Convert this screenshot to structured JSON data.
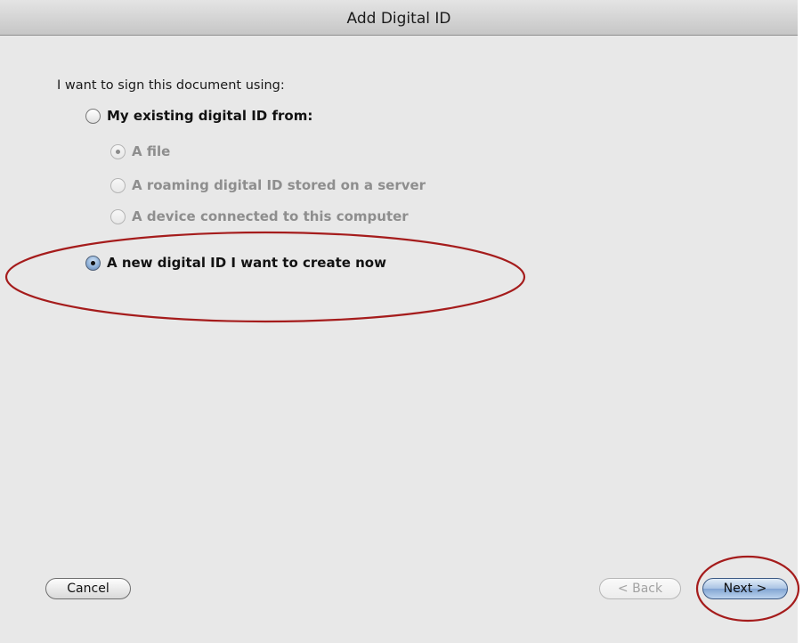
{
  "dialog": {
    "title": "Add Digital ID",
    "prompt": "I want to sign this document using:"
  },
  "options": {
    "existing": {
      "label": "My existing digital ID from:",
      "selected": false
    },
    "file": {
      "label": "A file",
      "selected": true,
      "enabled": false
    },
    "roaming": {
      "label": "A roaming digital ID stored on a server",
      "selected": false,
      "enabled": false
    },
    "device": {
      "label": "A device connected to this computer",
      "selected": false,
      "enabled": false
    },
    "new_id": {
      "label": "A new digital ID I want to create now",
      "selected": true
    }
  },
  "buttons": {
    "cancel": "Cancel",
    "back": "< Back",
    "next": "Next >"
  },
  "colors": {
    "annotation": "#a51c1c",
    "background": "#e8e8e8",
    "default_button": "#82a5d3"
  }
}
